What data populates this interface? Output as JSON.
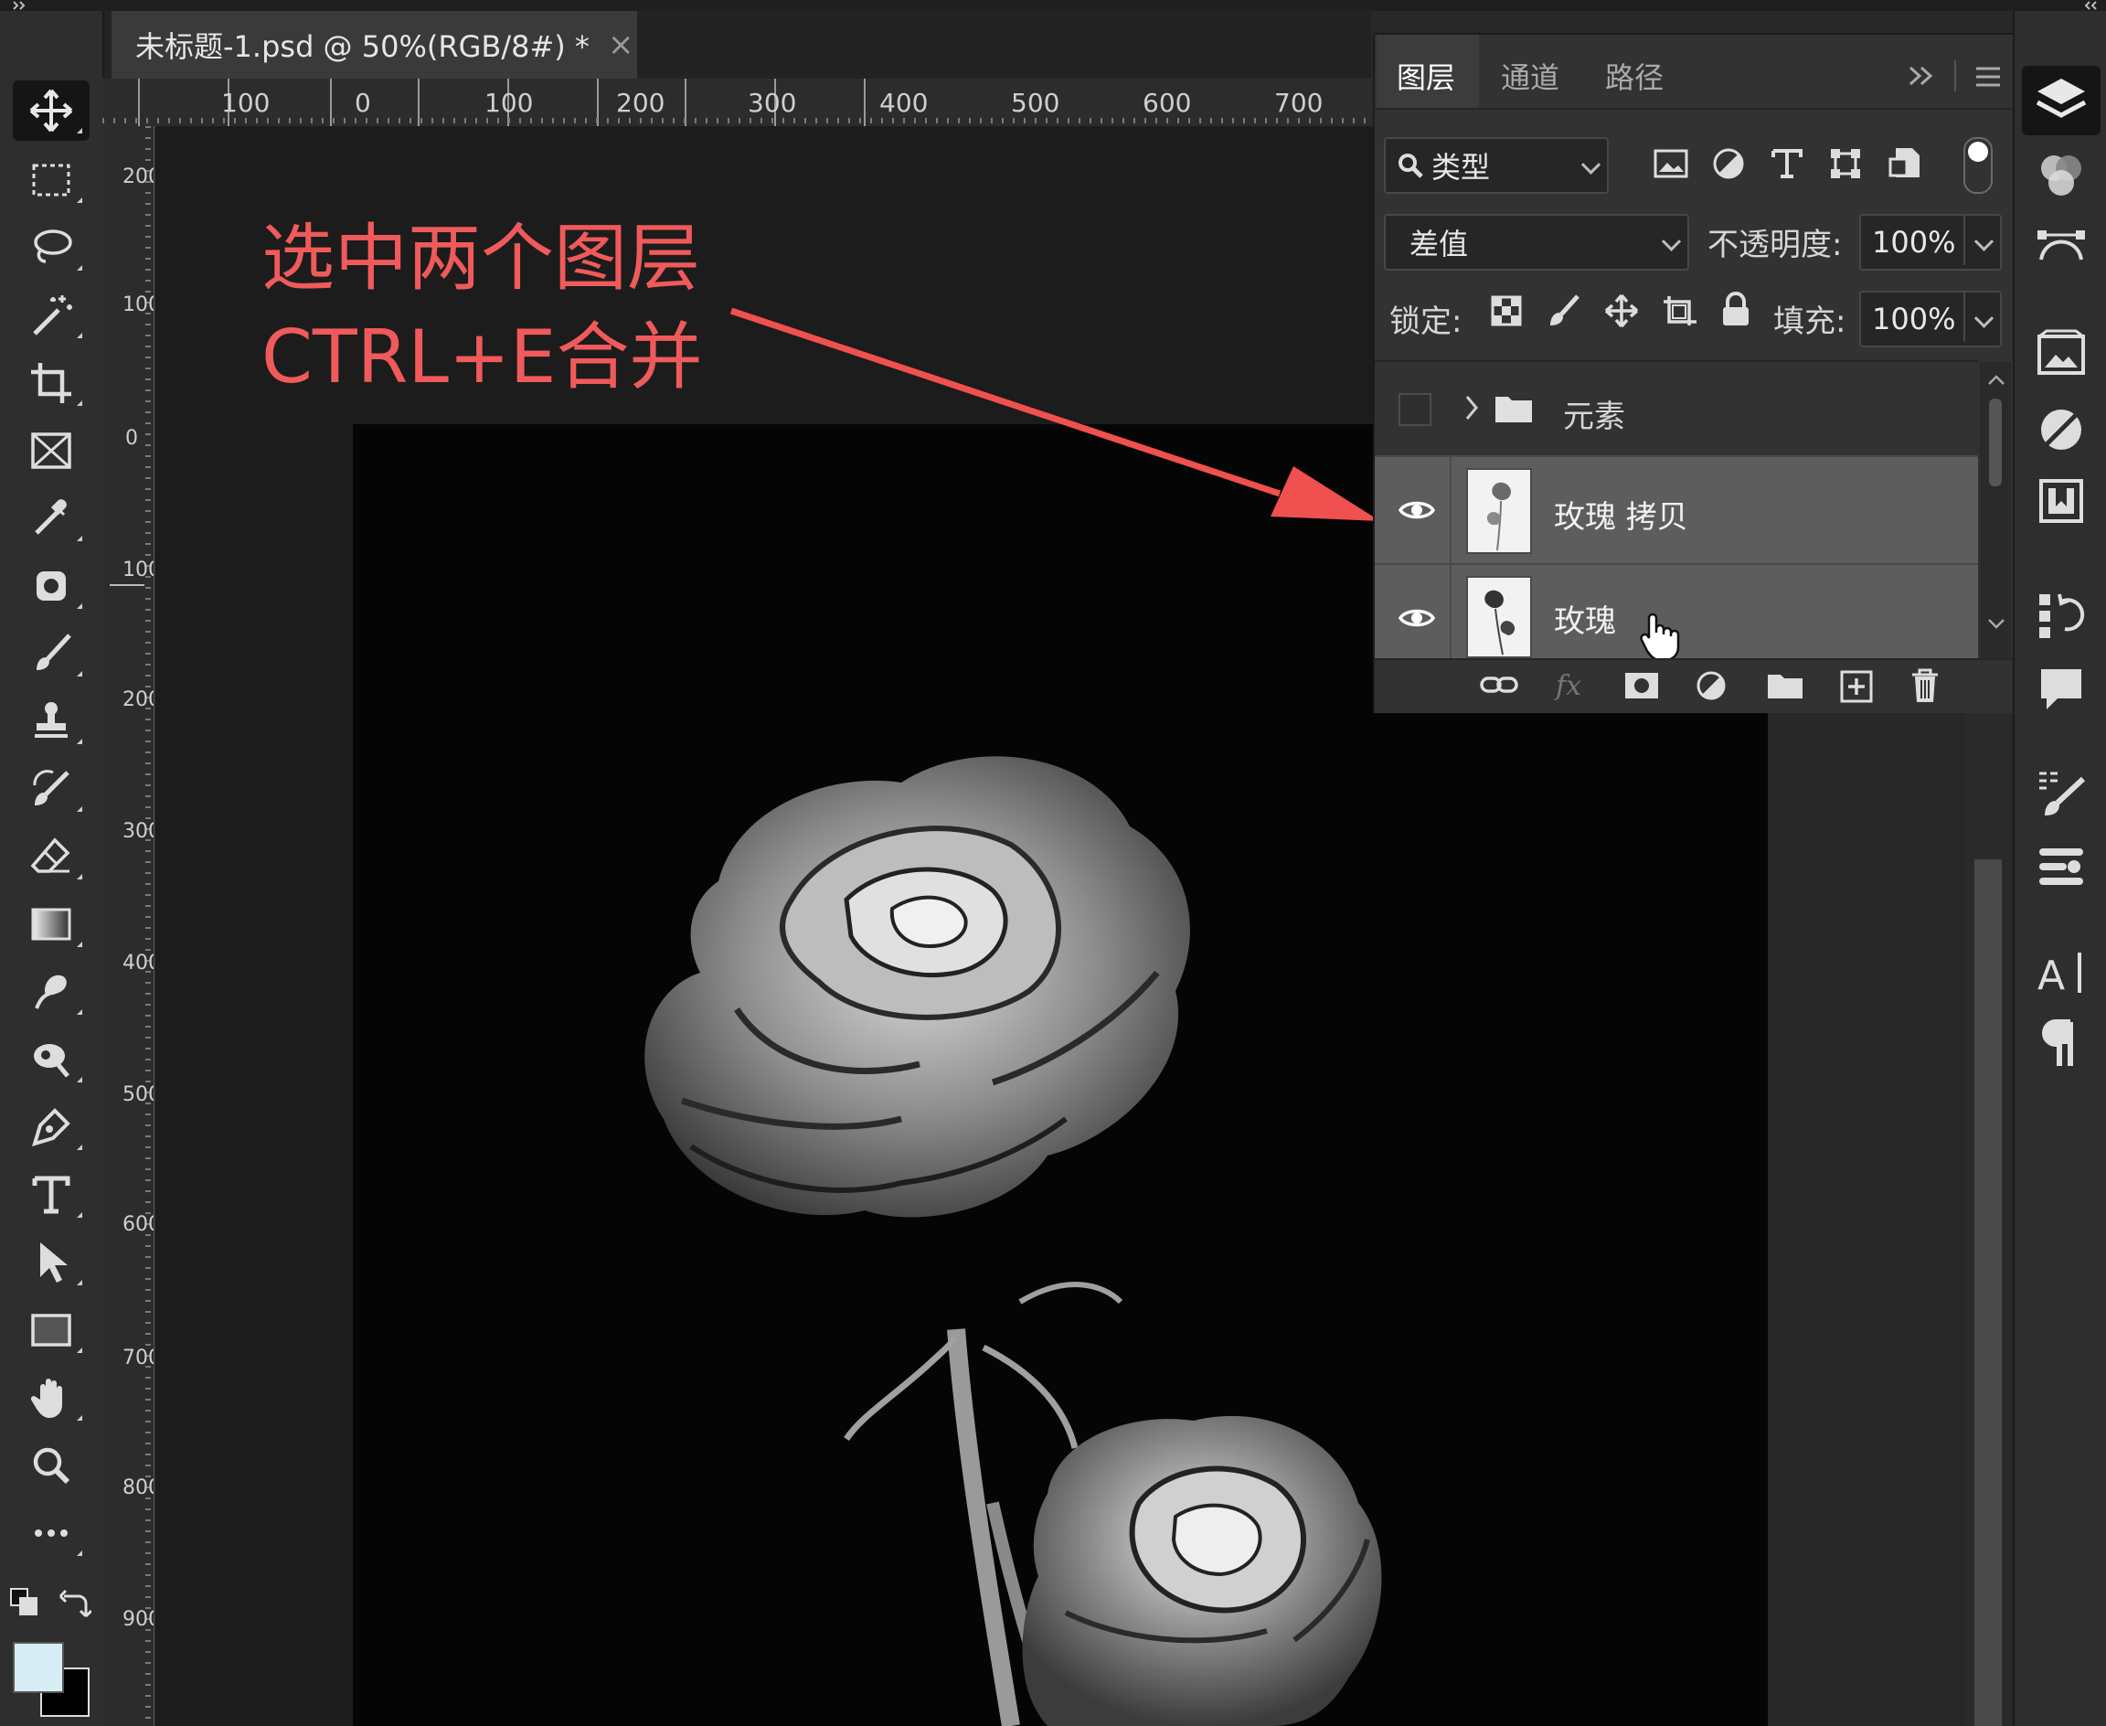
{
  "document": {
    "tab_title": "未标题-1.psd @ 50%(RGB/8#) *",
    "close_glyph": "×"
  },
  "rulers": {
    "horizontal": [
      "100",
      "0",
      "100",
      "200",
      "300",
      "400",
      "500",
      "600",
      "700"
    ],
    "vertical": [
      "200",
      "100",
      "0",
      "100",
      "200",
      "300",
      "400",
      "500",
      "600",
      "700",
      "800",
      "900"
    ]
  },
  "annotation": {
    "line1": "选中两个图层",
    "line2": "CTRL+E合并",
    "color": "#f05a5a"
  },
  "layers_panel": {
    "tabs": [
      "图层",
      "通道",
      "路径"
    ],
    "active_tab": "图层",
    "filter_kind": "类型",
    "blend_mode": "差值",
    "opacity_label": "不透明度:",
    "opacity_value": "100%",
    "lock_label": "锁定:",
    "fill_label": "填充:",
    "fill_value": "100%",
    "layers": [
      {
        "name": "元素",
        "type": "group",
        "visible": false,
        "selected": false
      },
      {
        "name": "玫瑰 拷贝",
        "type": "pixel",
        "visible": true,
        "selected": true
      },
      {
        "name": "玫瑰",
        "type": "pixel",
        "visible": true,
        "selected": true
      }
    ]
  },
  "toolbar": {
    "tools": [
      "move-tool",
      "rectangular-marquee-tool",
      "lasso-tool",
      "magic-wand-tool",
      "crop-tool",
      "frame-tool",
      "eyedropper-tool",
      "spot-healing-tool",
      "brush-tool",
      "clone-stamp-tool",
      "history-brush-tool",
      "eraser-tool",
      "gradient-tool",
      "blur-tool",
      "dodge-tool",
      "pen-tool",
      "type-tool",
      "path-selection-tool",
      "rectangle-tool",
      "hand-tool",
      "zoom-tool",
      "more-tools"
    ],
    "active_tool": "move-tool",
    "foreground_color": "#d8eef6",
    "background_color": "#000000"
  },
  "dock_icons": [
    "layers-icon",
    "channels-icon",
    "paths-icon",
    "libraries-icon",
    "adjustments-icon",
    "properties-icon",
    "history-icon",
    "comments-icon",
    "brush-settings-icon",
    "brushes-icon",
    "character-icon",
    "paragraph-icon"
  ]
}
